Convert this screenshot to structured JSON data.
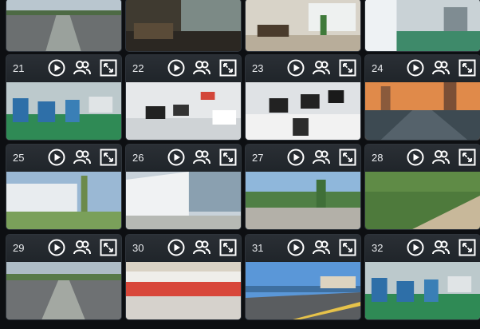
{
  "tiles": [
    {
      "scene": "road"
    },
    {
      "scene": "lobby"
    },
    {
      "scene": "office-interior"
    },
    {
      "scene": "corridor"
    },
    {
      "channel": "21",
      "scene": "factory-floor"
    },
    {
      "channel": "22",
      "scene": "open-office"
    },
    {
      "channel": "23",
      "scene": "desk-office"
    },
    {
      "channel": "24",
      "scene": "city-road-sunset"
    },
    {
      "channel": "25",
      "scene": "building-exterior"
    },
    {
      "channel": "26",
      "scene": "facade-corner"
    },
    {
      "channel": "27",
      "scene": "plaza"
    },
    {
      "channel": "28",
      "scene": "park-path"
    },
    {
      "channel": "29",
      "scene": "road"
    },
    {
      "channel": "30",
      "scene": "canteen"
    },
    {
      "channel": "31",
      "scene": "seaside-road"
    },
    {
      "channel": "32",
      "scene": "factory-floor"
    }
  ],
  "controls": {
    "play": "play-icon",
    "users": "users-icon",
    "fullscreen": "fullscreen-icon"
  },
  "colors": {
    "background": "#0d0f12",
    "toolbar": "#2a2f35",
    "icon": "#ffffff"
  }
}
